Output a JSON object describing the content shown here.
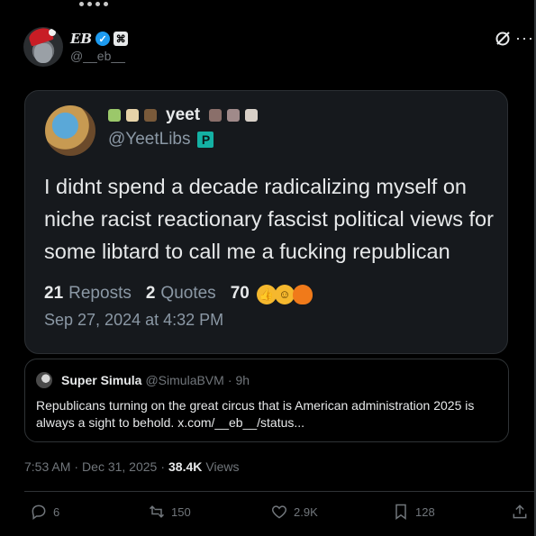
{
  "author": {
    "display_name": "EB",
    "handle": "@__eb__"
  },
  "embedded_post": {
    "display_name": "yeet",
    "handle": "@YeetLibs",
    "badge": "P",
    "text": "I didnt spend a decade radicalizing myself on niche racist reactionary fascist political views for some libtard to call me a fucking republican",
    "reposts_count": "21",
    "reposts_label": "Reposts",
    "quotes_count": "2",
    "quotes_label": "Quotes",
    "likes_count": "70",
    "date": "Sep 27, 2024 at 4:32 PM"
  },
  "quoted_tweet": {
    "name": "Super Simula",
    "handle": "@SimulaBVM",
    "sep": "·",
    "age": "9h",
    "text": "Republicans turning on the great circus that is American administration 2025 is always a sight to behold. x.com/__eb__/status..."
  },
  "post_meta": {
    "time": "7:53 AM",
    "sep": "·",
    "date": "Dec 31, 2025",
    "sep2": "·",
    "views_count": "38.4K",
    "views_label": "Views"
  },
  "actions": {
    "replies": "6",
    "reposts": "150",
    "likes": "2.9K",
    "bookmarks": "128"
  },
  "colors": {
    "accent": "#1d9bf0",
    "background": "#000000",
    "card": "#16191d",
    "muted": "#71767b"
  }
}
